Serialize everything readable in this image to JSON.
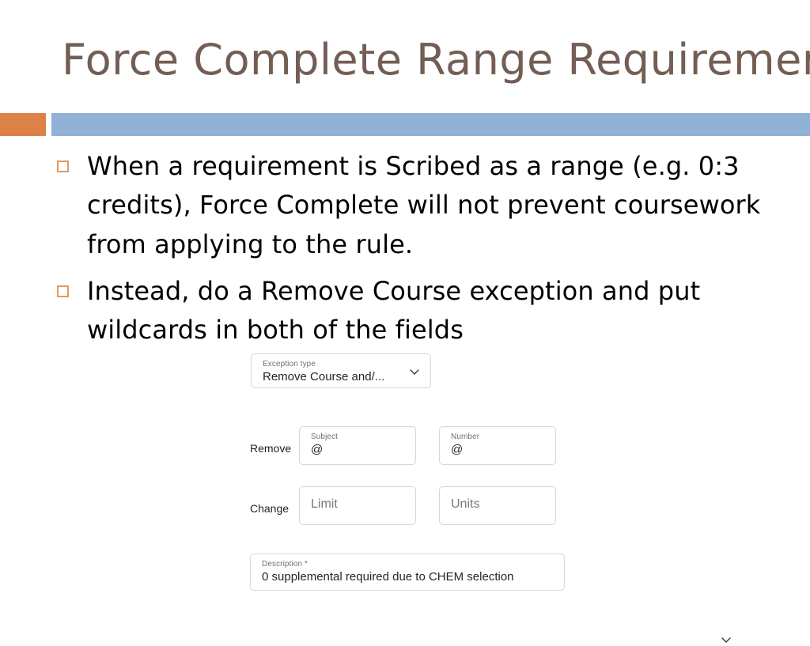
{
  "slide": {
    "title": "Force Complete Range Requirement",
    "title_color": "#735E54",
    "accent_block_color": "#DD8247",
    "divider_bar_color": "#90B2D4",
    "bullet_marker_color": "#DD9A63",
    "bullets": [
      "When a requirement is Scribed as a range (e.g. 0:3 credits), Force Complete will not prevent coursework from applying to the rule.",
      "Instead, do a Remove Course exception and put wildcards in both of the fields"
    ]
  },
  "form": {
    "exception_type": {
      "label": "Exception type",
      "value": "Remove Course and/...",
      "chevron": "chevron-down-icon"
    },
    "remove_row": {
      "label": "Remove",
      "subject": {
        "label": "Subject",
        "value": "@"
      },
      "number": {
        "label": "Number",
        "value": "@"
      }
    },
    "change_row": {
      "label": "Change",
      "limit": {
        "placeholder": "Limit",
        "value": ""
      },
      "units": {
        "placeholder": "Units",
        "value": "",
        "chevron": "chevron-down-icon"
      }
    },
    "description": {
      "label": "Description *",
      "value": "0 supplemental required due to CHEM selection"
    }
  }
}
